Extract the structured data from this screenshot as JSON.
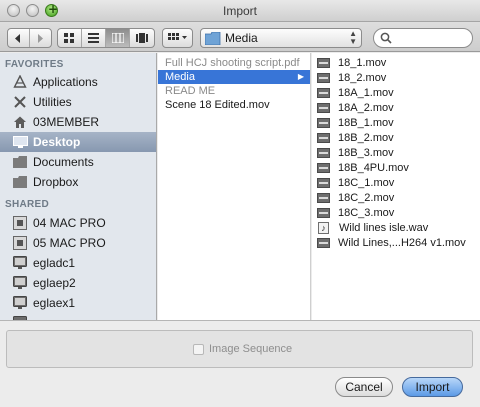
{
  "window": {
    "title": "Import"
  },
  "toolbar": {
    "path_label": "Media",
    "search_placeholder": ""
  },
  "sidebar": {
    "favorites_header": "FAVORITES",
    "shared_header": "SHARED",
    "favorites": [
      {
        "label": "Applications",
        "icon": "applications-icon"
      },
      {
        "label": "Utilities",
        "icon": "utilities-icon"
      },
      {
        "label": "03MEMBER",
        "icon": "home-icon"
      },
      {
        "label": "Desktop",
        "icon": "desktop-icon",
        "selected": true
      },
      {
        "label": "Documents",
        "icon": "folder-icon"
      },
      {
        "label": "Dropbox",
        "icon": "folder-icon"
      }
    ],
    "shared": [
      {
        "label": "04 MAC PRO",
        "icon": "server-icon"
      },
      {
        "label": "05 MAC PRO",
        "icon": "server-icon"
      },
      {
        "label": "egladc1",
        "icon": "monitor-icon"
      },
      {
        "label": "eglaep2",
        "icon": "monitor-icon"
      },
      {
        "label": "eglaex1",
        "icon": "monitor-icon"
      }
    ]
  },
  "column1": {
    "items": [
      {
        "label": "Full HCJ shooting script.pdf",
        "state": "dim"
      },
      {
        "label": "Media",
        "state": "selected"
      },
      {
        "label": "READ ME",
        "state": "dim"
      },
      {
        "label": "Scene 18 Edited.mov",
        "state": "normal"
      }
    ]
  },
  "column2": {
    "items": [
      {
        "label": "18_1.mov",
        "kind": "video"
      },
      {
        "label": "18_2.mov",
        "kind": "video"
      },
      {
        "label": "18A_1.mov",
        "kind": "video"
      },
      {
        "label": "18A_2.mov",
        "kind": "video"
      },
      {
        "label": "18B_1.mov",
        "kind": "video"
      },
      {
        "label": "18B_2.mov",
        "kind": "video"
      },
      {
        "label": "18B_3.mov",
        "kind": "video"
      },
      {
        "label": "18B_4PU.mov",
        "kind": "video"
      },
      {
        "label": "18C_1.mov",
        "kind": "video"
      },
      {
        "label": "18C_2.mov",
        "kind": "video"
      },
      {
        "label": "18C_3.mov",
        "kind": "video"
      },
      {
        "label": "Wild lines isle.wav",
        "kind": "audio"
      },
      {
        "label": "Wild Lines,...H264 v1.mov",
        "kind": "video"
      }
    ]
  },
  "options": {
    "image_sequence_label": "Image Sequence",
    "image_sequence_checked": false
  },
  "buttons": {
    "cancel": "Cancel",
    "import": "Import"
  }
}
